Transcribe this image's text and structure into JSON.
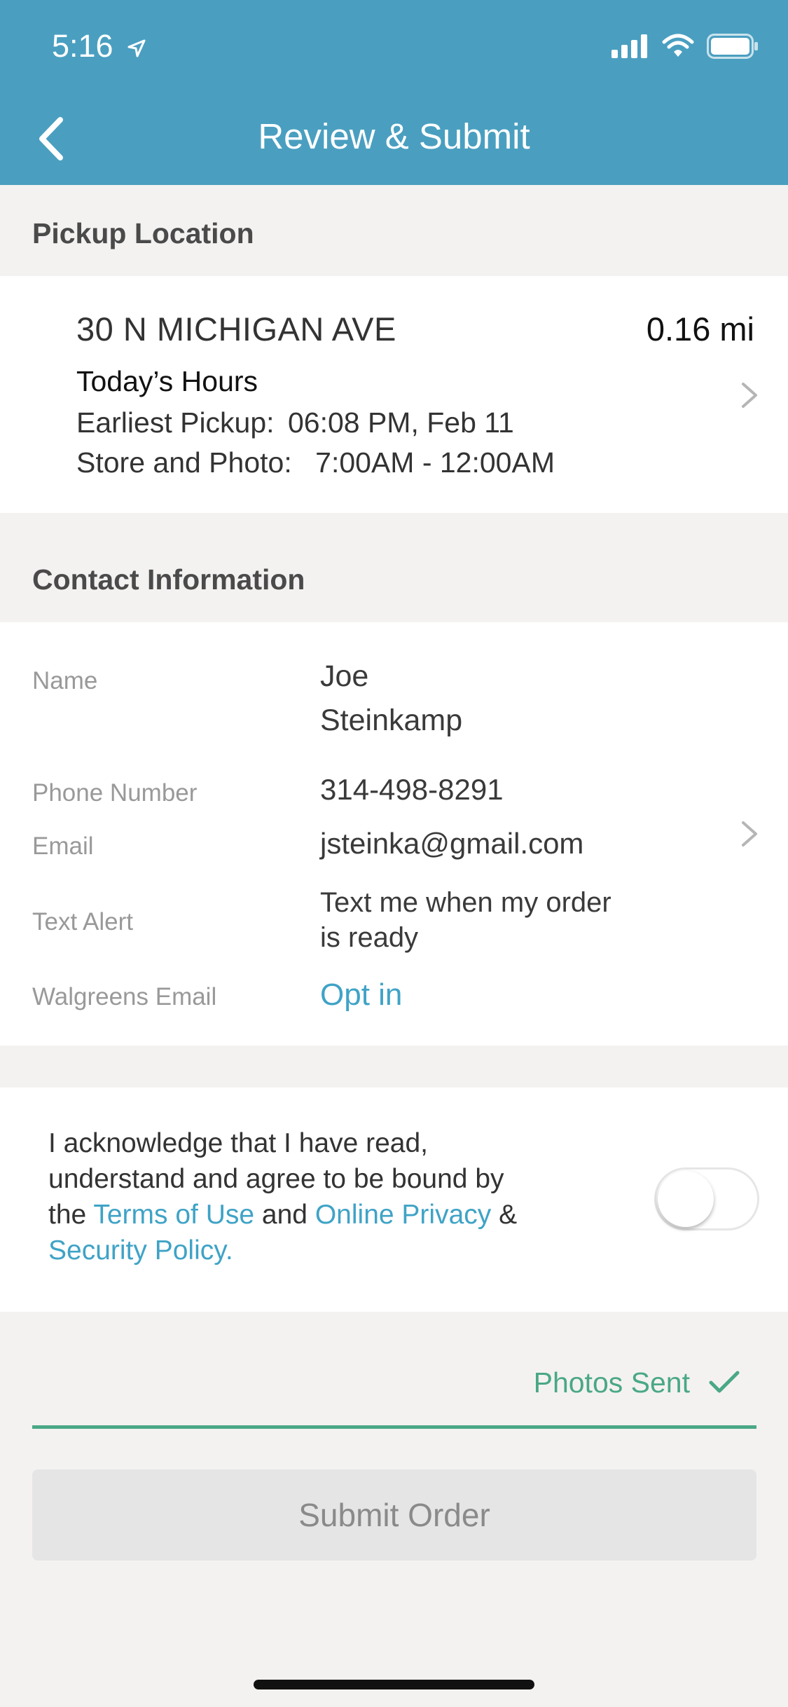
{
  "status_bar": {
    "time": "5:16"
  },
  "nav": {
    "title": "Review & Submit"
  },
  "pickup": {
    "section_title": "Pickup Location",
    "address": "30 N MICHIGAN AVE",
    "distance": "0.16 mi",
    "hours_title": "Today’s Hours",
    "earliest_label": "Earliest Pickup:",
    "earliest_value": "06:08 PM, Feb 11",
    "store_label": "Store and Photo:",
    "store_value": "7:00AM - 12:00AM"
  },
  "contact": {
    "section_title": "Contact Information",
    "name_label": "Name",
    "name_first": "Joe",
    "name_last": "Steinkamp",
    "phone_label": "Phone Number",
    "phone_value": "314-498-8291",
    "email_label": "Email",
    "email_value": "jsteinka@gmail.com",
    "text_alert_label": "Text Alert",
    "text_alert_line1": "Text me when my order",
    "text_alert_line2": "is ready",
    "walgreens_email_label": "Walgreens Email",
    "walgreens_email_value": "Opt in"
  },
  "acknowledge": {
    "line1": "I acknowledge that I have read,",
    "line2": "understand and agree to be bound by",
    "the": "the",
    "terms_link": "Terms of Use",
    "and": "and",
    "privacy_link": "Online Privacy",
    "amp": "&",
    "security_link": "Security Policy.",
    "toggle_on": false
  },
  "photos_status": "Photos Sent",
  "submit_label": "Submit Order",
  "colors": {
    "header": "#4a9fc0",
    "link": "#3fa3c6",
    "success": "#4aa886",
    "disabled_button": "#e5e5e5"
  }
}
